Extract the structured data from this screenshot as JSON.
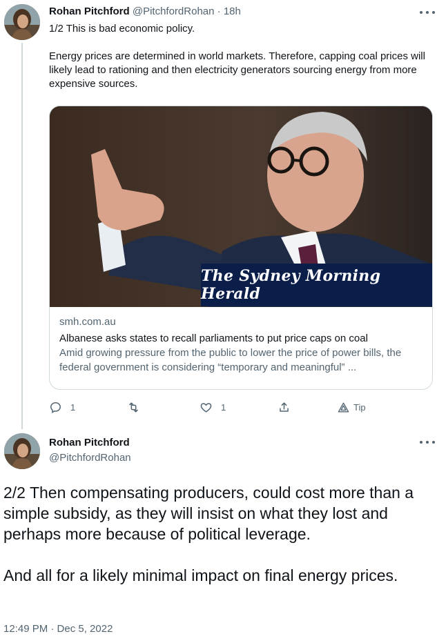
{
  "tweet1": {
    "name": "Rohan Pitchford",
    "handle": "@PitchfordRohan",
    "separator": "·",
    "time": "18h",
    "paragraphs": [
      "1/2 This is bad economic policy.",
      "Energy prices are determined in world markets. Therefore, capping coal prices will likely lead to rationing and then electricity generators sourcing energy from more expensive sources."
    ],
    "card": {
      "masthead": "The Sydney Morning Herald",
      "domain": "smh.com.au",
      "title": "Albanese asks states to recall parliaments to put price caps on coal",
      "description": "Amid growing pressure from the public to lower the price of power bills, the federal government is considering “temporary and meaningful” ..."
    },
    "actions": {
      "reply_count": "1",
      "retweet_count": "",
      "like_count": "1",
      "tip_label": "Tip"
    }
  },
  "tweet2": {
    "name": "Rohan Pitchford",
    "handle": "@PitchfordRohan",
    "paragraphs": [
      "2/2 Then compensating producers, could cost more than a simple subsidy, as they will insist on what they lost and perhaps more because of political leverage.",
      "And all for a likely minimal impact on final energy prices."
    ],
    "timestamp": "12:49 PM · Dec 5, 2022"
  },
  "colors": {
    "text_primary": "#0f1419",
    "text_secondary": "#536471",
    "border": "#cfd9de",
    "masthead_bg": "#0b1e4a"
  }
}
